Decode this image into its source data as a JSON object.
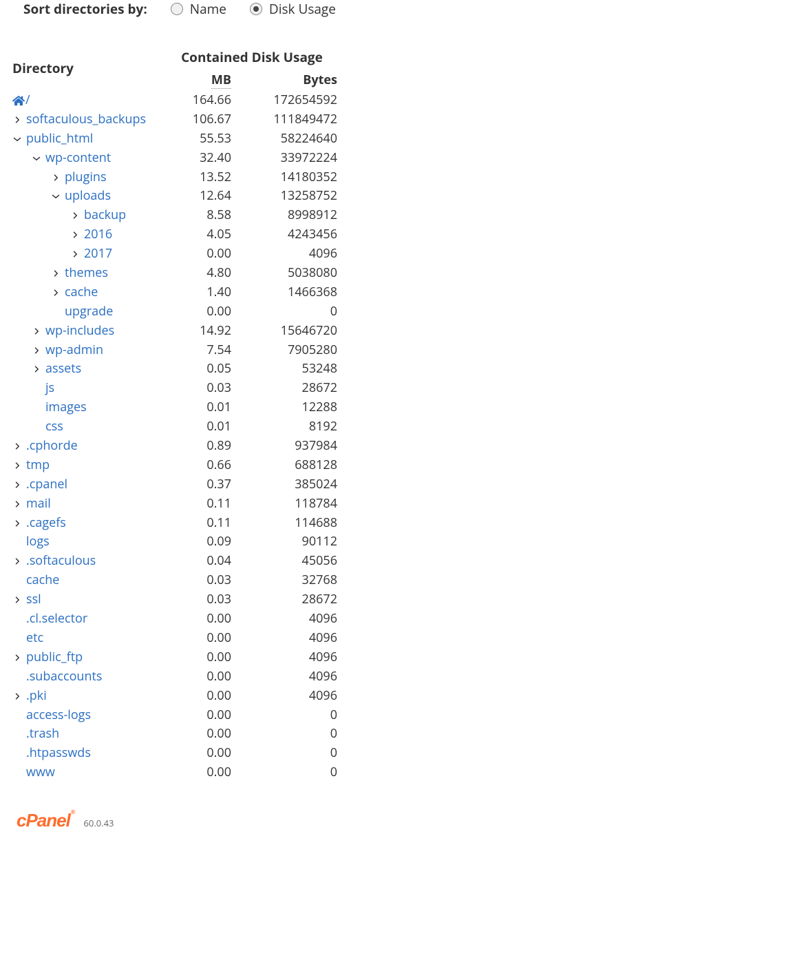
{
  "sort": {
    "label": "Sort directories by:",
    "options": {
      "name": "Name",
      "usage": "Disk Usage"
    },
    "selected": "usage"
  },
  "headers": {
    "directory": "Directory",
    "usage": "Contained Disk Usage",
    "mb": "MB",
    "bytes": "Bytes"
  },
  "root": {
    "slash": "/",
    "mb": "164.66",
    "bytes": "172654592"
  },
  "rows": [
    {
      "level": 1,
      "arrow": "right",
      "name": "softaculous_backups",
      "mb": "106.67",
      "bytes": "111849472"
    },
    {
      "level": 1,
      "arrow": "down",
      "name": "public_html",
      "mb": "55.53",
      "bytes": "58224640"
    },
    {
      "level": 2,
      "arrow": "down",
      "name": "wp-content",
      "mb": "32.40",
      "bytes": "33972224"
    },
    {
      "level": 3,
      "arrow": "right",
      "name": "plugins",
      "mb": "13.52",
      "bytes": "14180352"
    },
    {
      "level": 3,
      "arrow": "down",
      "name": "uploads",
      "mb": "12.64",
      "bytes": "13258752"
    },
    {
      "level": 4,
      "arrow": "right",
      "name": "backup",
      "mb": "8.58",
      "bytes": "8998912"
    },
    {
      "level": 4,
      "arrow": "right",
      "name": "2016",
      "mb": "4.05",
      "bytes": "4243456"
    },
    {
      "level": 4,
      "arrow": "right",
      "name": "2017",
      "mb": "0.00",
      "bytes": "4096"
    },
    {
      "level": 3,
      "arrow": "right",
      "name": "themes",
      "mb": "4.80",
      "bytes": "5038080"
    },
    {
      "level": 3,
      "arrow": "right",
      "name": "cache",
      "mb": "1.40",
      "bytes": "1466368"
    },
    {
      "level": 3,
      "arrow": "none",
      "name": "upgrade",
      "mb": "0.00",
      "bytes": "0"
    },
    {
      "level": 2,
      "arrow": "right",
      "name": "wp-includes",
      "mb": "14.92",
      "bytes": "15646720"
    },
    {
      "level": 2,
      "arrow": "right",
      "name": "wp-admin",
      "mb": "7.54",
      "bytes": "7905280"
    },
    {
      "level": 2,
      "arrow": "right",
      "name": "assets",
      "mb": "0.05",
      "bytes": "53248"
    },
    {
      "level": 2,
      "arrow": "none",
      "name": "js",
      "mb": "0.03",
      "bytes": "28672"
    },
    {
      "level": 2,
      "arrow": "none",
      "name": "images",
      "mb": "0.01",
      "bytes": "12288"
    },
    {
      "level": 2,
      "arrow": "none",
      "name": "css",
      "mb": "0.01",
      "bytes": "8192"
    },
    {
      "level": 1,
      "arrow": "right",
      "name": ".cphorde",
      "mb": "0.89",
      "bytes": "937984"
    },
    {
      "level": 1,
      "arrow": "right",
      "name": "tmp",
      "mb": "0.66",
      "bytes": "688128"
    },
    {
      "level": 1,
      "arrow": "right",
      "name": ".cpanel",
      "mb": "0.37",
      "bytes": "385024"
    },
    {
      "level": 1,
      "arrow": "right",
      "name": "mail",
      "mb": "0.11",
      "bytes": "118784"
    },
    {
      "level": 1,
      "arrow": "right",
      "name": ".cagefs",
      "mb": "0.11",
      "bytes": "114688"
    },
    {
      "level": 1,
      "arrow": "none",
      "name": "logs",
      "mb": "0.09",
      "bytes": "90112"
    },
    {
      "level": 1,
      "arrow": "right",
      "name": ".softaculous",
      "mb": "0.04",
      "bytes": "45056"
    },
    {
      "level": 1,
      "arrow": "none",
      "name": "cache",
      "mb": "0.03",
      "bytes": "32768"
    },
    {
      "level": 1,
      "arrow": "right",
      "name": "ssl",
      "mb": "0.03",
      "bytes": "28672"
    },
    {
      "level": 1,
      "arrow": "none",
      "name": ".cl.selector",
      "mb": "0.00",
      "bytes": "4096"
    },
    {
      "level": 1,
      "arrow": "none",
      "name": "etc",
      "mb": "0.00",
      "bytes": "4096"
    },
    {
      "level": 1,
      "arrow": "right",
      "name": "public_ftp",
      "mb": "0.00",
      "bytes": "4096"
    },
    {
      "level": 1,
      "arrow": "none",
      "name": ".subaccounts",
      "mb": "0.00",
      "bytes": "4096"
    },
    {
      "level": 1,
      "arrow": "right",
      "name": ".pki",
      "mb": "0.00",
      "bytes": "4096"
    },
    {
      "level": 1,
      "arrow": "none",
      "name": "access-logs",
      "mb": "0.00",
      "bytes": "0"
    },
    {
      "level": 1,
      "arrow": "none",
      "name": ".trash",
      "mb": "0.00",
      "bytes": "0"
    },
    {
      "level": 1,
      "arrow": "none",
      "name": ".htpasswds",
      "mb": "0.00",
      "bytes": "0"
    },
    {
      "level": 1,
      "arrow": "none",
      "name": "www",
      "mb": "0.00",
      "bytes": "0"
    }
  ],
  "footer": {
    "brand": "cPanel",
    "version": "60.0.43"
  }
}
